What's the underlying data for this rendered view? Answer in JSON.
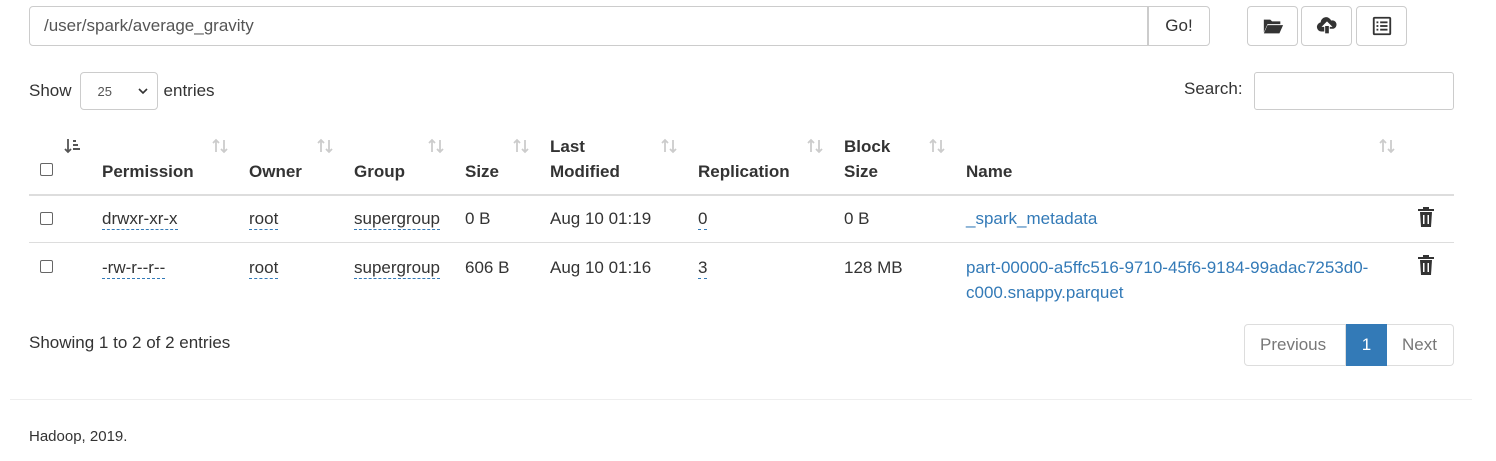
{
  "path_bar": {
    "value": "/user/spark/average_gravity",
    "go_label": "Go!"
  },
  "toolbar": {
    "icons": [
      "folder-open-icon",
      "cloud-upload-icon",
      "list-alt-icon"
    ]
  },
  "length": {
    "show_label": "Show",
    "selected": "25",
    "entries_label": "entries"
  },
  "search": {
    "label": "Search:"
  },
  "table": {
    "headers": {
      "permission": "Permission",
      "owner": "Owner",
      "group": "Group",
      "size": "Size",
      "last_modified_1": "Last",
      "last_modified_2": "Modified",
      "replication": "Replication",
      "block_size_1": "Block",
      "block_size_2": "Size",
      "name": "Name"
    },
    "rows": [
      {
        "permission": "drwxr-xr-x",
        "owner": "root",
        "group": "supergroup",
        "size": "0 B",
        "last_modified": "Aug 10 01:19",
        "replication": "0",
        "block_size": "0 B",
        "name_1": "_spark_metadata",
        "name_2": ""
      },
      {
        "permission": "-rw-r--r--",
        "owner": "root",
        "group": "supergroup",
        "size": "606 B",
        "last_modified": "Aug 10 01:16",
        "replication": "3",
        "block_size": "128 MB",
        "name_1": "part-00000-a5ffc516-9710-45f6-9184-99adac7253d0-",
        "name_2": "c000.snappy.parquet"
      }
    ]
  },
  "info": "Showing 1 to 2 of 2 entries",
  "pagination": {
    "previous": "Previous",
    "current": "1",
    "next": "Next"
  },
  "footer": "Hadoop, 2019.",
  "colors": {
    "link": "#337ab7",
    "active_page": "#337ab7",
    "border": "#dddddd"
  }
}
